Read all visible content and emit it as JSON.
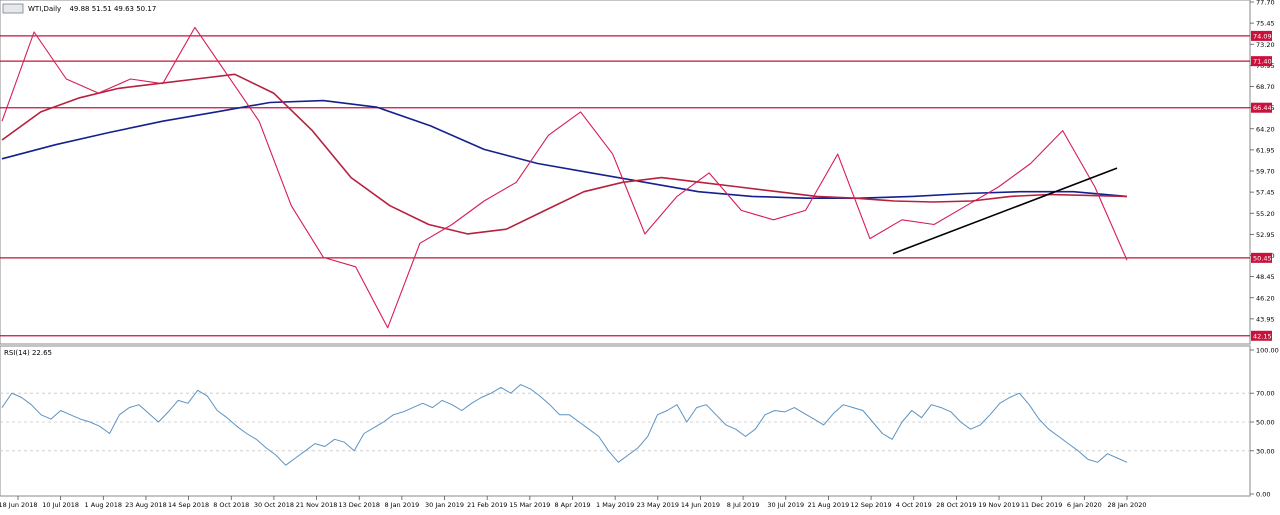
{
  "header": {
    "symbol": "WTI,Daily",
    "ohlc": "49.88 51.51 49.63 50.17"
  },
  "rsi_panel": {
    "label": "RSI(14) 22.65"
  },
  "colors": {
    "price_line": "#d81b5a",
    "sma_fast": "#b5213f",
    "sma_slow": "#15208f",
    "trendline": "#000000",
    "rsi_line": "#5b93c4",
    "level_box": "#c8123c"
  },
  "chart_data": [
    {
      "type": "line",
      "grid": false,
      "ylim": [
        41.7,
        77.7
      ],
      "yticks": [
        43.95,
        46.2,
        48.45,
        50.7,
        52.95,
        55.2,
        57.45,
        59.7,
        61.95,
        64.2,
        66.45,
        68.7,
        70.95,
        73.2,
        75.45,
        77.7
      ],
      "x_dates": [
        "18 Jun 2018",
        "10 Jul 2018",
        "1 Aug 2018",
        "23 Aug 2018",
        "14 Sep 2018",
        "8 Oct 2018",
        "30 Oct 2018",
        "21 Nov 2018",
        "13 Dec 2018",
        "8 Jan 2019",
        "30 Jan 2019",
        "21 Feb 2019",
        "15 Mar 2019",
        "8 Apr 2019",
        "1 May 2019",
        "23 May 2019",
        "14 Jun 2019",
        "8 Jul 2019",
        "30 Jul 2019",
        "21 Aug 2019",
        "12 Sep 2019",
        "4 Oct 2019",
        "28 Oct 2019",
        "19 Nov 2019",
        "11 Dec 2019",
        "6 Jan 2020",
        "28 Jan 2020"
      ],
      "series": [
        {
          "role": "price",
          "values": [
            65.0,
            74.5,
            69.5,
            68.0,
            69.5,
            69.0,
            75.0,
            70.0,
            65.0,
            56.0,
            50.5,
            49.5,
            43.0,
            52.0,
            54.0,
            56.5,
            58.5,
            63.5,
            66.0,
            61.5,
            53.0,
            57.0,
            59.5,
            55.5,
            54.5,
            55.5,
            61.5,
            52.5,
            54.5,
            54.0,
            56.0,
            58.0,
            60.5,
            64.0,
            58.0,
            50.2
          ]
        },
        {
          "role": "sma_fast",
          "values": [
            63.0,
            66.0,
            67.5,
            68.5,
            69.0,
            69.5,
            70.0,
            68.0,
            64.0,
            59.0,
            56.0,
            54.0,
            53.0,
            53.5,
            55.5,
            57.5,
            58.5,
            59.0,
            58.5,
            58.0,
            57.5,
            57.0,
            56.8,
            56.5,
            56.4,
            56.5,
            57.0,
            57.2,
            57.1,
            57.0
          ]
        },
        {
          "role": "sma_slow",
          "values": [
            61.0,
            62.5,
            63.8,
            65.0,
            66.0,
            67.0,
            67.2,
            66.5,
            64.5,
            62.0,
            60.5,
            59.5,
            58.5,
            57.5,
            57.0,
            56.8,
            56.8,
            57.0,
            57.3,
            57.5,
            57.5,
            57.0
          ]
        }
      ],
      "levels": [
        74.09,
        71.4,
        66.44,
        50.45,
        42.15
      ]
    },
    {
      "type": "line",
      "grid": false,
      "ylim": [
        0,
        100
      ],
      "yticks": [
        0.0,
        30.0,
        50.0,
        70.0,
        100.0
      ],
      "x_dates": [],
      "series": [
        {
          "role": "rsi",
          "values": [
            60,
            70,
            67,
            62,
            55,
            52,
            58,
            55,
            52,
            50,
            47,
            42,
            55,
            60,
            62,
            56,
            50,
            57,
            65,
            63,
            72,
            68,
            58,
            53,
            47,
            42,
            38,
            32,
            27,
            20,
            25,
            30,
            35,
            33,
            38,
            36,
            30,
            42,
            46,
            50,
            55,
            57,
            60,
            63,
            60,
            65,
            62,
            58,
            63,
            67,
            70,
            74,
            70,
            76,
            73,
            68,
            62,
            55,
            55,
            50,
            45,
            40,
            30,
            22,
            27,
            32,
            40,
            55,
            58,
            62,
            50,
            60,
            62,
            55,
            48,
            45,
            40,
            45,
            55,
            58,
            57,
            60,
            56,
            52,
            48,
            56,
            62,
            60,
            58,
            50,
            42,
            38,
            50,
            58,
            53,
            62,
            60,
            57,
            50,
            45,
            48,
            55,
            63,
            67,
            70,
            62,
            52,
            45,
            40,
            35,
            30,
            24,
            22,
            28,
            25,
            22
          ]
        }
      ]
    }
  ]
}
